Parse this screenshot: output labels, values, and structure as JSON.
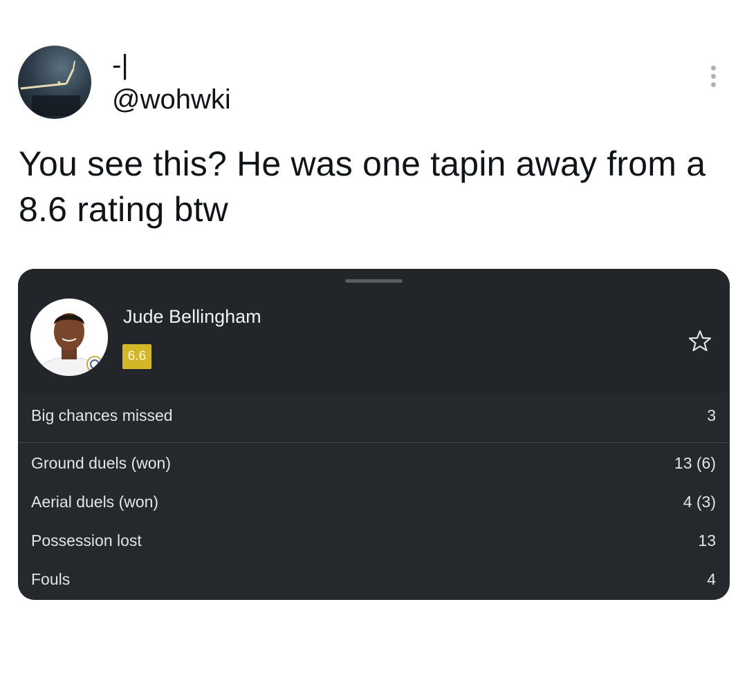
{
  "tweet": {
    "display_name": "-|",
    "handle": "@wohwki",
    "text": "You see this? He was one tapin away from a 8.6 rating btw",
    "more_icon": "more-vertical-icon"
  },
  "card": {
    "player_name": "Jude Bellingham",
    "rating": "6.6",
    "rating_color": "#d3b727",
    "favorite_icon": "star-outline-icon",
    "stats": [
      {
        "label": "Big chances missed",
        "value": "3"
      },
      {
        "label": "Ground duels (won)",
        "value": "13 (6)"
      },
      {
        "label": "Aerial duels (won)",
        "value": "4 (3)"
      },
      {
        "label": "Possession lost",
        "value": "13"
      },
      {
        "label": "Fouls",
        "value": "4"
      }
    ]
  },
  "colors": {
    "card_background": "#25282c",
    "text_primary": "#0f1419"
  }
}
